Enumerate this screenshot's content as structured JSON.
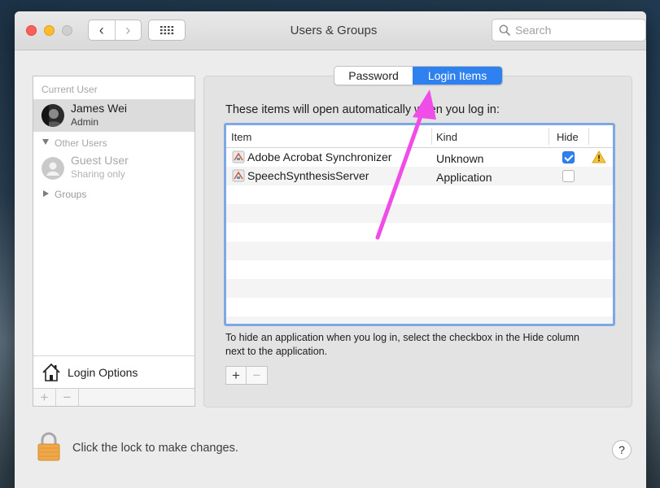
{
  "window": {
    "title": "Users & Groups",
    "nav_back": "‹",
    "nav_forward": "›"
  },
  "search": {
    "placeholder": "Search",
    "value": ""
  },
  "sidebar": {
    "current_user_header": "Current User",
    "current_user": {
      "name": "James Wei",
      "role": "Admin"
    },
    "other_users_header": "Other Users",
    "guest": {
      "name": "Guest User",
      "status": "Sharing only"
    },
    "groups_label": "Groups",
    "login_options_label": "Login Options",
    "add": "+",
    "remove": "−"
  },
  "tabs": [
    {
      "label": "Password",
      "selected": false
    },
    {
      "label": "Login Items",
      "selected": true
    }
  ],
  "login_items": {
    "intro": "These items will open automatically when you log in:",
    "columns": {
      "item": "Item",
      "kind": "Kind",
      "hide": "Hide"
    },
    "rows": [
      {
        "item": "Adobe Acrobat Synchronizer",
        "kind": "Unknown",
        "hide": true,
        "warning": true
      },
      {
        "item": "SpeechSynthesisServer",
        "kind": "Application",
        "hide": false,
        "warning": false
      }
    ],
    "note": "To hide an application when you log in, select the checkbox in the Hide column next to the application.",
    "add": "+",
    "remove": "−"
  },
  "footer": {
    "lock_text": "Click the lock to make changes.",
    "help": "?"
  },
  "colors": {
    "accent": "#2f81f0",
    "annotation_arrow": "#f04de8",
    "warning": "#f5c43a"
  }
}
